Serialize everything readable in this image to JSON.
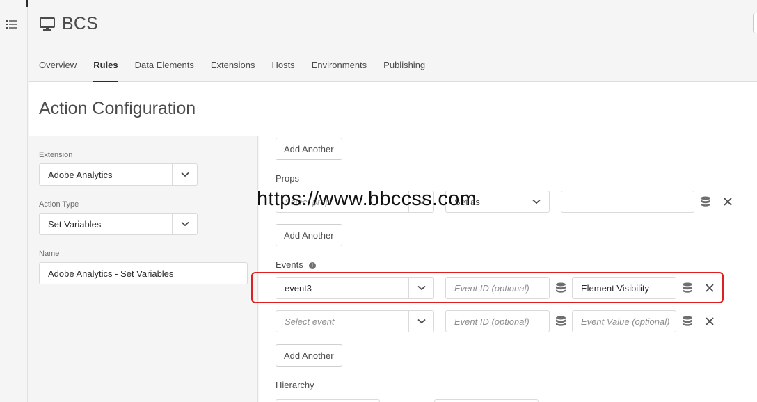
{
  "rail": {
    "menu_icon": "list-icon"
  },
  "header": {
    "property_name": "BCS",
    "property_icon": "monitor-icon",
    "tabs": [
      {
        "label": "Overview"
      },
      {
        "label": "Rules",
        "active": true
      },
      {
        "label": "Data Elements"
      },
      {
        "label": "Extensions"
      },
      {
        "label": "Hosts"
      },
      {
        "label": "Environments"
      },
      {
        "label": "Publishing"
      }
    ]
  },
  "page": {
    "title": "Action Configuration"
  },
  "left_form": {
    "extension": {
      "label": "Extension",
      "value": "Adobe Analytics"
    },
    "action_type": {
      "label": "Action Type",
      "value": "Set Variables"
    },
    "name": {
      "label": "Name",
      "value": "Adobe Analytics - Set Variables"
    }
  },
  "right_panel": {
    "add_another_top": "Add Another",
    "props": {
      "label": "Props",
      "row": {
        "prop_placeholder": "Select prop",
        "mode_value": "Set as",
        "value": ""
      },
      "add_another": "Add Another"
    },
    "events": {
      "label": "Events",
      "info_icon": "info-icon",
      "rows": [
        {
          "event": "event3",
          "event_id_placeholder": "Event ID (optional)",
          "event_value": "Element Visibility",
          "highlighted": true
        },
        {
          "event_placeholder": "Select event",
          "event_id_placeholder": "Event ID (optional)",
          "event_value_placeholder": "Event Value (optional)"
        }
      ],
      "add_another": "Add Another"
    },
    "hierarchy": {
      "label": "Hierarchy"
    }
  },
  "watermark": "https://www.bbccss.com",
  "colors": {
    "highlight": "#e01f1f",
    "page_bg": "#f5f5f5",
    "panel_bg": "#ffffff"
  }
}
